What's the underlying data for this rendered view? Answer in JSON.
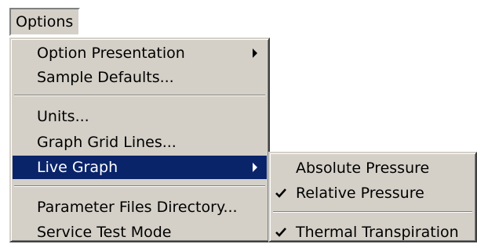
{
  "menubar": {
    "options_label": "Options"
  },
  "main_menu": {
    "items": [
      {
        "label": "Option Presentation",
        "has_submenu": true
      },
      {
        "label": "Sample Defaults..."
      },
      {
        "label": "Units..."
      },
      {
        "label": "Graph Grid Lines..."
      },
      {
        "label": "Live Graph",
        "has_submenu": true,
        "highlighted": true
      },
      {
        "label": "Parameter Files Directory..."
      },
      {
        "label": "Service Test Mode"
      }
    ]
  },
  "live_graph_submenu": {
    "items": [
      {
        "label": "Absolute Pressure",
        "checked": false
      },
      {
        "label": "Relative Pressure",
        "checked": true
      },
      {
        "label": "Thermal Transpiration",
        "checked": true
      }
    ]
  },
  "colors": {
    "menu_background": "#d4d0c8",
    "highlight": "#0a246a",
    "highlight_text": "#ffffff"
  },
  "icons": {
    "submenu_arrow": "triangle-right",
    "check": "checkmark"
  }
}
